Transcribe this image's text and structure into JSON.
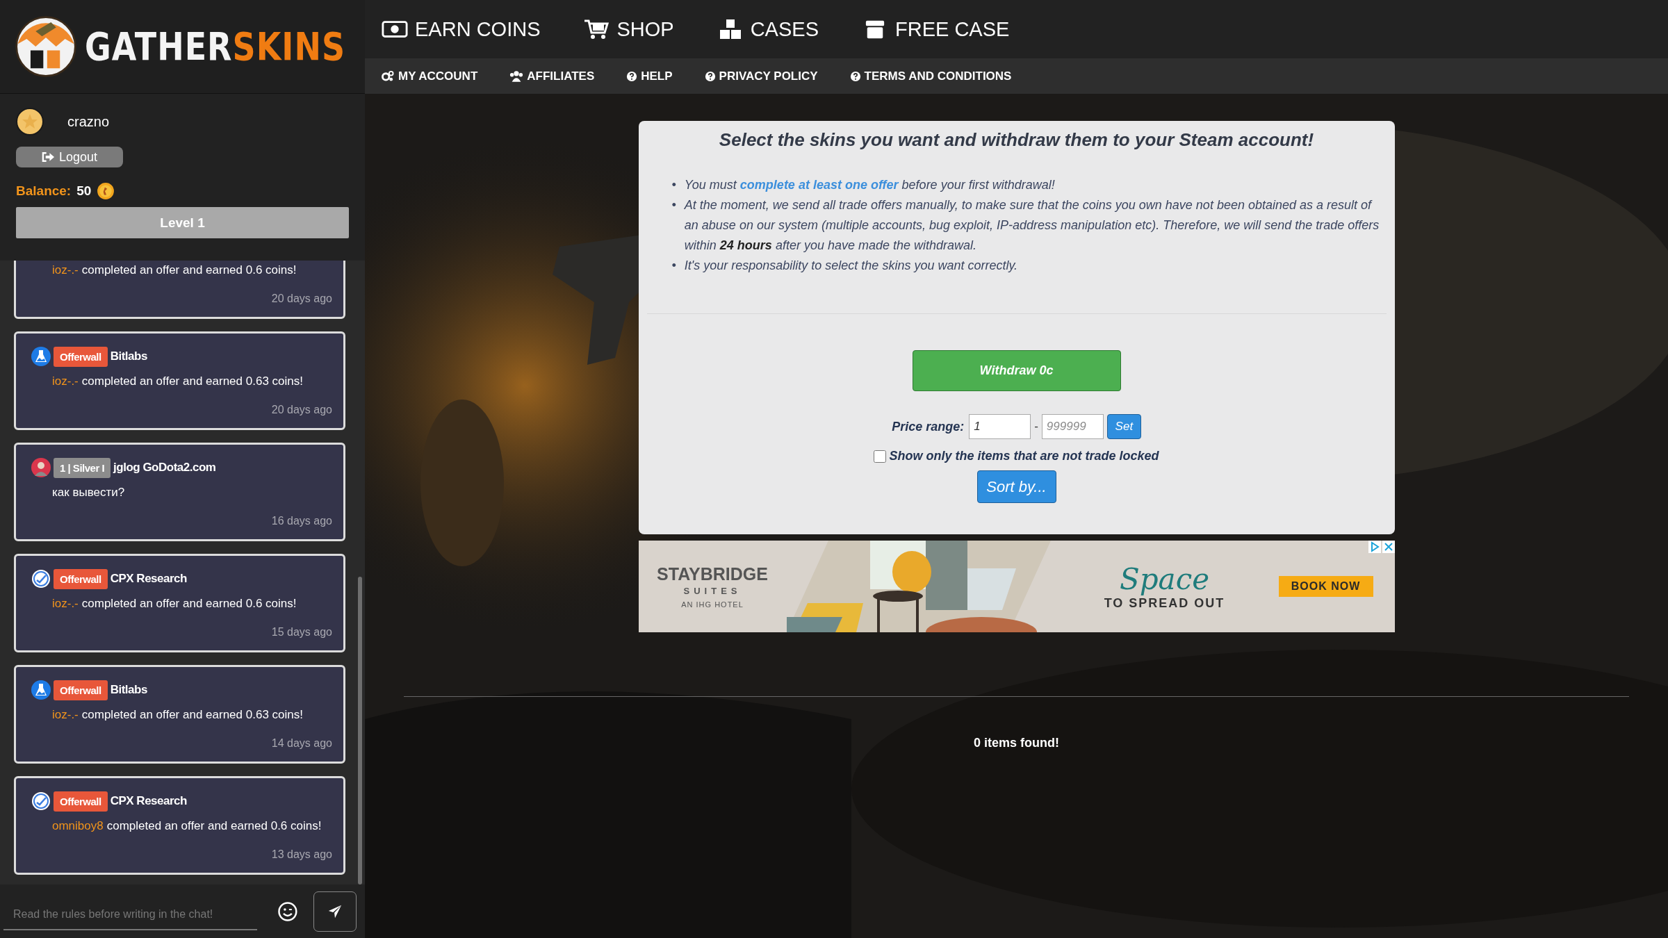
{
  "logo": {
    "part_1": "GATHER",
    "part_2": "SKINS"
  },
  "user": {
    "name": "crazno",
    "logout": "Logout",
    "balance_label": "Balance:",
    "balance": "50",
    "level": "Level 1"
  },
  "feed": [
    {
      "kind": "partial",
      "user": "ioz-.-",
      "message": "completed an offer and earned 0.6 coins!",
      "time": "20 days ago"
    },
    {
      "kind": "bitlabs",
      "badge": "Offerwall",
      "color": "#e8573a",
      "source": "Bitlabs",
      "user": "ioz-.-",
      "message": "completed an offer and earned 0.63 coins!",
      "time": "20 days ago"
    },
    {
      "kind": "chat",
      "badge": "1 | Silver I",
      "color": "#8c8c8c",
      "source": "jglog GoDota2.com",
      "message": "как вывести?",
      "time": "16 days ago"
    },
    {
      "kind": "cpx",
      "badge": "Offerwall",
      "color": "#e8573a",
      "source": "CPX Research",
      "user": "ioz-.-",
      "message": "completed an offer and earned 0.6 coins!",
      "time": "15 days ago"
    },
    {
      "kind": "bitlabs",
      "badge": "Offerwall",
      "color": "#e8573a",
      "source": "Bitlabs",
      "user": "ioz-.-",
      "message": "completed an offer and earned 0.63 coins!",
      "time": "14 days ago"
    },
    {
      "kind": "cpx",
      "badge": "Offerwall",
      "color": "#e8573a",
      "source": "CPX Research",
      "user": "omniboy8",
      "message": "completed an offer and earned 0.6 coins!",
      "time": "13 days ago"
    }
  ],
  "chat_input": {
    "placeholder": "Read the rules before writing in the chat!"
  },
  "nav": [
    "EARN COINS",
    "SHOP",
    "CASES",
    "FREE CASE"
  ],
  "subnav": [
    "MY ACCOUNT",
    "AFFILIATES",
    "HELP",
    "PRIVACY POLICY",
    "TERMS AND CONDITIONS"
  ],
  "withdraw_panel": {
    "title": "Select the skins you want and withdraw them to your Steam account!",
    "notes": [
      {
        "kind": "link",
        "marker": "•",
        "before": "You must",
        "link": "complete at least one offer",
        "after": "before your first withdrawal!"
      },
      {
        "kind": "text",
        "marker": "•",
        "text": "At the moment, we send all trade offers manually, to make sure that the coins you own have not been obtained as a result of an abuse on our system (multiple accounts, bug exploit, IP-address manipulation etc). Therefore, we will send the trade offers within **24 hours** after you have made the withdrawal."
      },
      {
        "kind": "text",
        "marker": "•",
        "text": "It's your responsability to select the skins you want correctly."
      }
    ],
    "withdraw_button": "Withdraw 0c",
    "price_range": {
      "label": "Price range:",
      "min": {
        "value": "1"
      },
      "separator": "-",
      "max": {
        "placeholder": "999999"
      },
      "set_button": "Set"
    },
    "trade_lock_filter": {
      "label": "Show only the items that are not trade locked",
      "checked": false
    },
    "sort_button": "Sort by..."
  },
  "ad": {
    "brand": "STAYBRIDGE",
    "brand_line_2": "SUITES",
    "brand_line_3": "AN IHG HOTEL",
    "headline": "Space",
    "tagline": "TO SPREAD OUT",
    "cta": "BOOK NOW"
  },
  "results": "0 items found!"
}
